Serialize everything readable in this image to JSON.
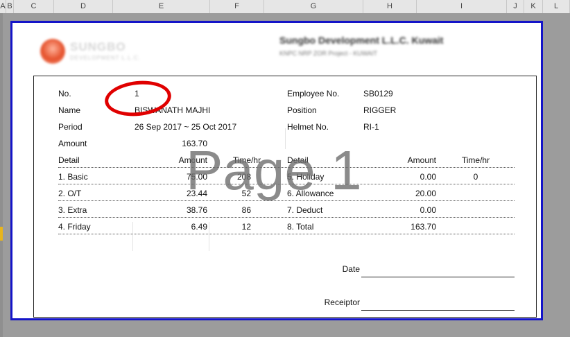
{
  "column_headers": [
    "A",
    "B",
    "C",
    "D",
    "E",
    "F",
    "G",
    "H",
    "I",
    "J",
    "K",
    "L"
  ],
  "letterhead": {
    "logo_text": "SUNGBO",
    "logo_subtext": "DEVELOPMENT L.L.C.",
    "company_name": "Sungbo Development L.L.C. Kuwait",
    "project": "KNPC NRP ZOR Project - KUWAIT"
  },
  "slip": {
    "no_label": "No.",
    "no_value": "1",
    "name_label": "Name",
    "name_value": "BISWANATH MAJHI",
    "period_label": "Period",
    "period_value": "26 Sep 2017 ~ 25 Oct 2017",
    "amount_label": "Amount",
    "amount_value": "163.70",
    "employee_no_label": "Employee No.",
    "employee_no_value": "SB0129",
    "position_label": "Position",
    "position_value": "RIGGER",
    "helmet_no_label": "Helmet No.",
    "helmet_no_value": "RI-1",
    "table_headers": {
      "detail": "Detail",
      "amount": "Amount",
      "time": "Time/hr"
    },
    "left_rows": [
      {
        "detail": "1. Basic",
        "amount": "75.00",
        "time": "208"
      },
      {
        "detail": "2. O/T",
        "amount": "23.44",
        "time": "52"
      },
      {
        "detail": "3. Extra",
        "amount": "38.76",
        "time": "86"
      },
      {
        "detail": "4. Friday",
        "amount": "6.49",
        "time": "12"
      }
    ],
    "right_rows": [
      {
        "detail": "5. Holiday",
        "amount": "0.00",
        "time": "0"
      },
      {
        "detail": "6. Allowance",
        "amount": "20.00",
        "time": ""
      },
      {
        "detail": "7. Deduct",
        "amount": "0.00",
        "time": ""
      },
      {
        "detail": "8. Total",
        "amount": "163.70",
        "time": ""
      }
    ],
    "date_label": "Date",
    "receiptor_label": "Receiptor"
  },
  "watermark": "Page 1",
  "colors": {
    "page_border": "#1414c8",
    "annotation": "#e00000",
    "sheet_bg": "#9c9c9c"
  }
}
